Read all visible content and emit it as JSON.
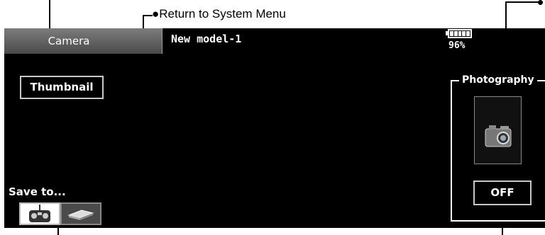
{
  "callouts": {
    "return_to_system_menu": "●Return to System Menu"
  },
  "header": {
    "title": "Camera",
    "model_name": "New model-1",
    "battery_percent": "96%",
    "battery_level": 0.96
  },
  "main": {
    "thumbnail_label": "Thumbnail",
    "photography_label": "Photography",
    "shutter_state": "OFF",
    "save_to_label": "Save to...",
    "save_to_selected": "transmitter"
  },
  "icons": {
    "camera": "camera-icon",
    "transmitter": "transmitter-icon",
    "sd_card": "sd-card-icon",
    "battery": "battery-icon"
  },
  "colors": {
    "screen_bg": "#000000",
    "tab_bg": "#5f5f5f",
    "text": "#ffffff"
  }
}
